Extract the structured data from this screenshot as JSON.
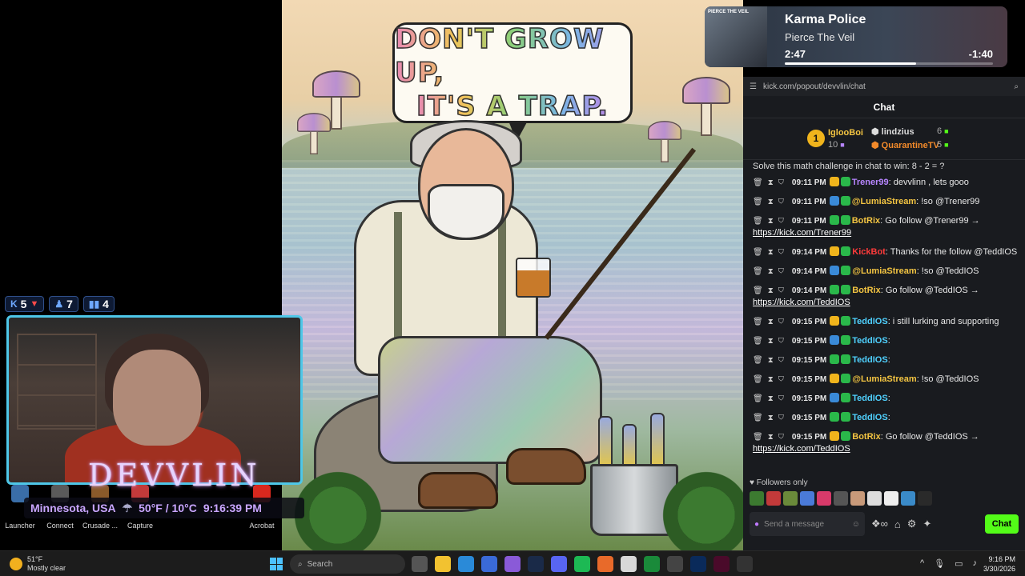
{
  "artwork": {
    "line1": "DON'T GROW UP,",
    "line2": "IT'S A TRAP."
  },
  "overlay": {
    "stats": [
      {
        "icon": "kick-icon",
        "value": "5"
      },
      {
        "icon": "follower-icon",
        "value": "7"
      },
      {
        "icon": "viewers-icon",
        "value": "4"
      }
    ],
    "brand": "DEVVLIN",
    "location": "Minnesota, USA",
    "weather": "50°F / 10°C",
    "time": "9:16:39 PM",
    "dock_apps": [
      "Launcher",
      "Connect",
      "Crusade ...",
      "Capture",
      "Acrobat"
    ]
  },
  "music": {
    "thumb_text": "PIERCE THE VEIL",
    "title": "Karma Police",
    "artist": "Pierce The Veil",
    "elapsed": "2:47",
    "remaining": "-1:40",
    "progress": 0.63
  },
  "chat": {
    "url": "kick.com/popout/devvlin/chat",
    "header": "Chat",
    "leaderboard": {
      "rank": "1",
      "top_name": "IglooBoi",
      "top_value": "10",
      "second_name": "lindzius",
      "second_value": "6",
      "third_name": "QuarantineTV",
      "third_value": "5"
    },
    "challenge": "Solve this math challenge in chat to win: 8 - 2 = ?",
    "messages": [
      {
        "time": "09:11 PM",
        "user": "Trener99",
        "color": "#b786ff",
        "text": ": devvlinn , lets gooo",
        "link": ""
      },
      {
        "time": "09:11 PM",
        "user": "@LumiaStream",
        "color": "#f4c542",
        "text": ": !so @Trener99",
        "link": ""
      },
      {
        "time": "09:11 PM",
        "user": "BotRix",
        "color": "#f4c542",
        "text": ": Go follow @Trener99 →",
        "link": "https://kick.com/Trener99"
      },
      {
        "time": "09:14 PM",
        "user": "KickBot",
        "color": "#ff3b3b",
        "text": ": Thanks for the follow @TeddIOS",
        "link": ""
      },
      {
        "time": "09:14 PM",
        "user": "@LumiaStream",
        "color": "#f4c542",
        "text": ": !so @TeddIOS",
        "link": ""
      },
      {
        "time": "09:14 PM",
        "user": "BotRix",
        "color": "#f4c542",
        "text": ": Go follow @TeddIOS →",
        "link": "https://kick.com/TeddIOS"
      },
      {
        "time": "09:15 PM",
        "user": "TeddIOS",
        "color": "#4fd1ff",
        "text": ": i still lurking and supporting",
        "link": ""
      },
      {
        "time": "09:15 PM",
        "user": "TeddIOS",
        "color": "#4fd1ff",
        "text": ":",
        "link": ""
      },
      {
        "time": "09:15 PM",
        "user": "TeddIOS",
        "color": "#4fd1ff",
        "text": ":",
        "link": ""
      },
      {
        "time": "09:15 PM",
        "user": "@LumiaStream",
        "color": "#f4c542",
        "text": ": !so @TeddIOS",
        "link": ""
      },
      {
        "time": "09:15 PM",
        "user": "TeddIOS",
        "color": "#4fd1ff",
        "text": ":",
        "link": ""
      },
      {
        "time": "09:15 PM",
        "user": "TeddIOS",
        "color": "#4fd1ff",
        "text": ":",
        "link": ""
      },
      {
        "time": "09:15 PM",
        "user": "BotRix",
        "color": "#f4c542",
        "text": ": Go follow @TeddIOS →",
        "link": "https://kick.com/TeddIOS"
      }
    ],
    "followers_label": "Followers only",
    "send_placeholder": "Send a message",
    "chat_button": "Chat"
  },
  "taskbar": {
    "temp": "51°F",
    "condition": "Mostly clear",
    "search_placeholder": "Search",
    "time": "9:16 PM",
    "date": "3/30/2026"
  }
}
